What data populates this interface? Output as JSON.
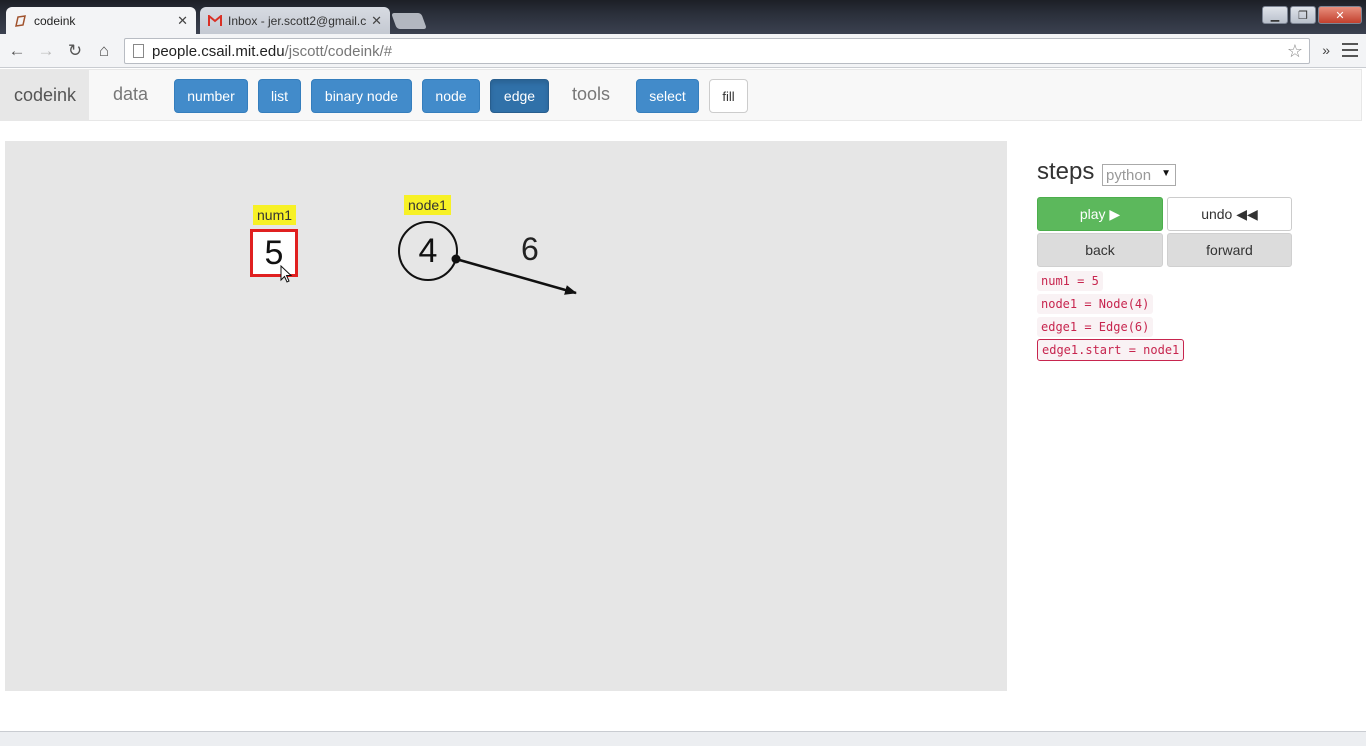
{
  "browser": {
    "tabs": [
      {
        "title": "codeink",
        "active": true
      },
      {
        "title": "Inbox - jer.scott2@gmail.c",
        "active": false
      }
    ],
    "url_host": "people.csail.mit.edu",
    "url_path": "/jscott/codeink/#",
    "ext_glyph": "»"
  },
  "navbar": {
    "brand": "codeink",
    "data_label": "data",
    "data_buttons": [
      "number",
      "list",
      "binary node",
      "node",
      "edge"
    ],
    "active_button": "edge",
    "tools_label": "tools",
    "tool_buttons": [
      "select",
      "fill"
    ]
  },
  "canvas": {
    "num_var": {
      "name": "num1",
      "value": "5"
    },
    "node_var": {
      "name": "node1",
      "value": "4"
    },
    "edge_weight": "6"
  },
  "steps": {
    "title": "steps",
    "language": "python",
    "play_label": "play ▶",
    "undo_label": "undo ◀◀",
    "back_label": "back",
    "forward_label": "forward",
    "code": [
      "num1 = 5",
      "node1 = Node(4)",
      "edge1 = Edge(6)",
      "edge1.start = node1"
    ],
    "current_step": 3
  },
  "colors": {
    "primary": "#428bca",
    "success": "#5cb85c",
    "highlight_label": "#f7f126",
    "selected_border": "#e02020",
    "code_text": "#c7254e"
  }
}
